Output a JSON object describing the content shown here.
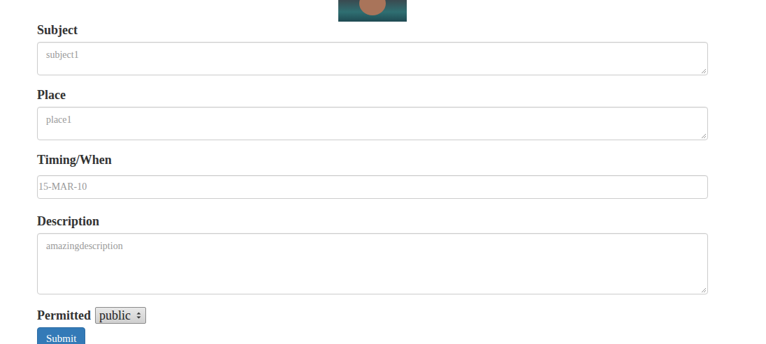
{
  "fields": [
    {
      "label": "Subject",
      "placeholder": "subject1",
      "kind": "textarea"
    },
    {
      "label": "Place",
      "placeholder": "place1",
      "kind": "textarea"
    },
    {
      "label": "Timing/When",
      "placeholder": "15-MAR-10",
      "kind": "input"
    },
    {
      "label": "Description",
      "placeholder": "amazingdescription",
      "kind": "bigtextarea"
    }
  ],
  "permission": {
    "label": "Permitted",
    "value": "public"
  },
  "submit": {
    "label": "Submit"
  }
}
